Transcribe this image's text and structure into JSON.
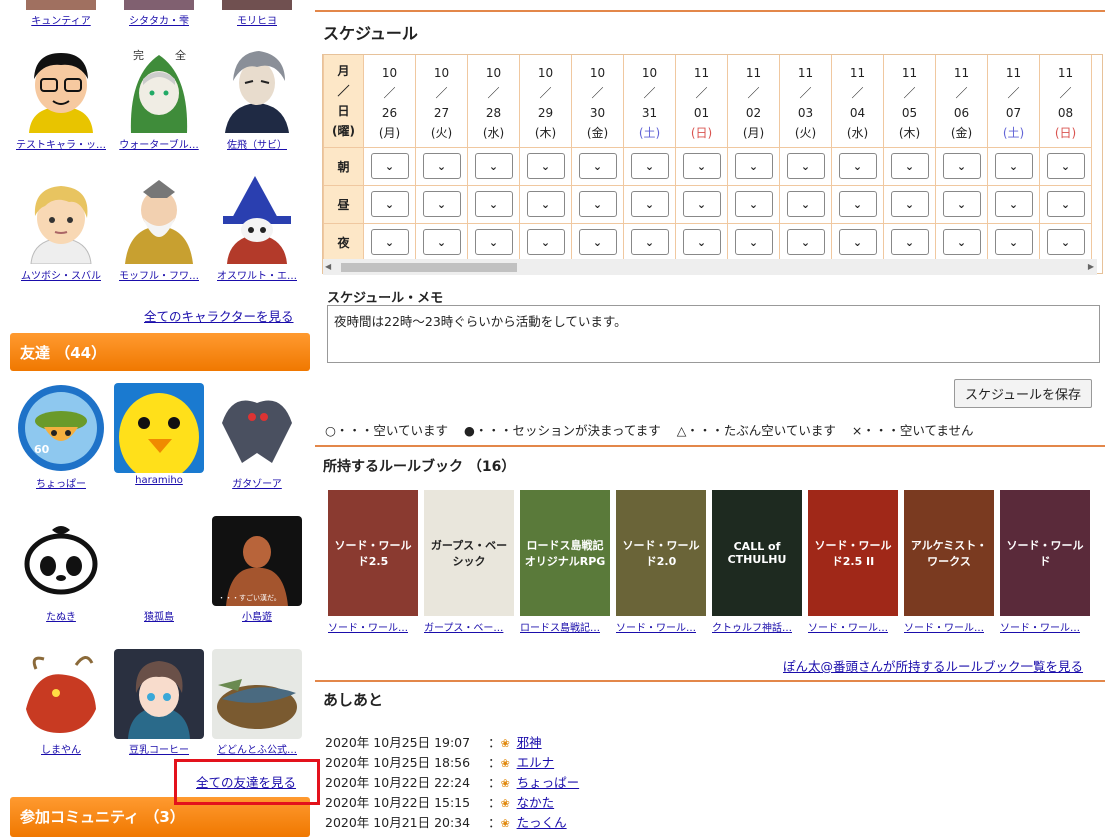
{
  "top_characters": [
    "キュンティア",
    "シタタカ・雫",
    "モリヒヨ"
  ],
  "characters": [
    {
      "name": "テストキャラ・ッ…"
    },
    {
      "name": "ウォーターブル…"
    },
    {
      "name": "佐飛（サビ）"
    },
    {
      "name": "ムツボシ・スバル"
    },
    {
      "name": "モッフル・フワ…"
    },
    {
      "name": "オスワルト・エ…"
    }
  ],
  "see_all_characters": "全てのキャラクターを見る",
  "friends": {
    "header": "友達 （44）",
    "list": [
      {
        "name": "ちょっぱー"
      },
      {
        "name": "haramiho"
      },
      {
        "name": "ガタゾーア"
      },
      {
        "name": "たぬき"
      },
      {
        "name": "猿孤島"
      },
      {
        "name": "小島遊"
      },
      {
        "name": "しまやん"
      },
      {
        "name": "豆乳コーヒー"
      },
      {
        "name": "どどんとふ公式…"
      }
    ],
    "see_all": "全ての友達を見る",
    "photo_caption": "・・・すごい漢だ。"
  },
  "community_header": "参加コミュニティ （3）",
  "schedule": {
    "title": "スケジュール",
    "label_header": [
      "月",
      "／",
      "日",
      "(曜)"
    ],
    "rows": [
      "朝",
      "昼",
      "夜"
    ],
    "slash": "／",
    "dates": [
      {
        "m": "10",
        "d": "26",
        "w": "(月)",
        "type": "weekday"
      },
      {
        "m": "10",
        "d": "27",
        "w": "(火)",
        "type": "weekday"
      },
      {
        "m": "10",
        "d": "28",
        "w": "(水)",
        "type": "weekday"
      },
      {
        "m": "10",
        "d": "29",
        "w": "(木)",
        "type": "weekday"
      },
      {
        "m": "10",
        "d": "30",
        "w": "(金)",
        "type": "weekday"
      },
      {
        "m": "10",
        "d": "31",
        "w": "(土)",
        "type": "sat"
      },
      {
        "m": "11",
        "d": "01",
        "w": "(日)",
        "type": "sun"
      },
      {
        "m": "11",
        "d": "02",
        "w": "(月)",
        "type": "weekday"
      },
      {
        "m": "11",
        "d": "03",
        "w": "(火)",
        "type": "weekday"
      },
      {
        "m": "11",
        "d": "04",
        "w": "(水)",
        "type": "weekday"
      },
      {
        "m": "11",
        "d": "05",
        "w": "(木)",
        "type": "weekday"
      },
      {
        "m": "11",
        "d": "06",
        "w": "(金)",
        "type": "weekday"
      },
      {
        "m": "11",
        "d": "07",
        "w": "(土)",
        "type": "sat"
      },
      {
        "m": "11",
        "d": "08",
        "w": "(日)",
        "type": "sun"
      }
    ],
    "memo_label": "スケジュール・メモ",
    "memo_text": "夜時間は22時～23時ぐらいから活動をしています。",
    "save_button": "スケジュールを保存",
    "legend": [
      "○・・・空いています",
      "●・・・セッションが決まってます",
      "△・・・たぶん空いています",
      "×・・・空いてません"
    ]
  },
  "rulebooks": {
    "title": "所持するルールブック （16）",
    "list": [
      {
        "name": "ソード・ワール…",
        "cover": "ソード・ワールド2.5",
        "color": "#8a3a30"
      },
      {
        "name": "ガープス・ベー…",
        "cover": "ガープス・ベーシック",
        "color": "#e9e6dc"
      },
      {
        "name": "ロードス島戦記…",
        "cover": "ロードス島戦記 オリジナルRPG",
        "color": "#5a7a3a"
      },
      {
        "name": "ソード・ワール…",
        "cover": "ソード・ワールド2.0",
        "color": "#6a6438"
      },
      {
        "name": "クトゥルフ神話…",
        "cover": "CALL of CTHULHU",
        "color": "#1e2a20"
      },
      {
        "name": "ソード・ワール…",
        "cover": "ソード・ワールド2.5 II",
        "color": "#a02818"
      },
      {
        "name": "ソード・ワール…",
        "cover": "アルケミスト・ワークス",
        "color": "#7a3a20"
      },
      {
        "name": "ソード・ワール…",
        "cover": "ソード・ワールド",
        "color": "#5a2a3a"
      }
    ],
    "see_all": "ぽん太@番頭さんが所持するルールブック一覧を見る"
  },
  "footprints": {
    "title": "あしあと",
    "list": [
      {
        "time": "2020年 10月25日 19:07",
        "name": "邪神"
      },
      {
        "time": "2020年 10月25日 18:56",
        "name": "エルナ"
      },
      {
        "time": "2020年 10月22日 22:24",
        "name": "ちょっぱー"
      },
      {
        "time": "2020年 10月22日 15:15",
        "name": "なかた"
      },
      {
        "time": "2020年 10月21日 20:34",
        "name": "たっくん"
      }
    ]
  },
  "colors": {
    "accent": "#f07800",
    "highlight": "#e3121c",
    "link": "#1a0dab"
  }
}
